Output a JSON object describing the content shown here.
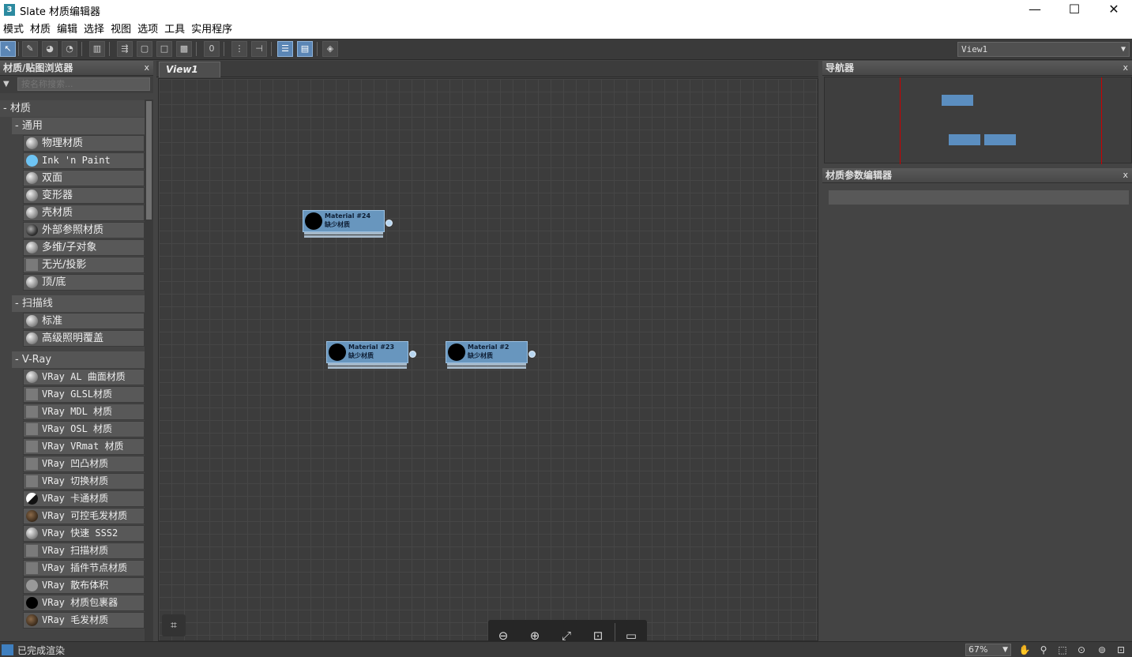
{
  "window": {
    "title": "Slate 材质编辑器",
    "app_icon": "3",
    "minimize": "—",
    "maximize": "☐",
    "close": "✕"
  },
  "menu": [
    "模式",
    "材质",
    "编辑",
    "选择",
    "视图",
    "选项",
    "工具",
    "实用程序"
  ],
  "toolbar": {
    "view_select": "View1"
  },
  "browser": {
    "title": "材质/贴图浏览器",
    "close": "x",
    "search_placeholder": "按名称搜索...",
    "root_label": "- 材质",
    "groups": [
      {
        "label": "- 通用",
        "items": [
          {
            "label": "物理材质",
            "swatch": "sph"
          },
          {
            "label": "Ink 'n Paint",
            "swatch": "blue"
          },
          {
            "label": "双面",
            "swatch": "sph"
          },
          {
            "label": "变形器",
            "swatch": "sph"
          },
          {
            "label": "壳材质",
            "swatch": "sph"
          },
          {
            "label": "外部参照材质",
            "swatch": "dark"
          },
          {
            "label": "多维/子对象",
            "swatch": "sph"
          },
          {
            "label": "无光/投影",
            "swatch": "sq"
          },
          {
            "label": "顶/底",
            "swatch": "sph"
          }
        ]
      },
      {
        "label": "- 扫描线",
        "items": [
          {
            "label": "标准",
            "swatch": "sph"
          },
          {
            "label": "高级照明覆盖",
            "swatch": "sph"
          }
        ]
      },
      {
        "label": "- V-Ray",
        "items": [
          {
            "label": "VRay AL 曲面材质",
            "swatch": "sph"
          },
          {
            "label": "VRay GLSL材质",
            "swatch": "sq"
          },
          {
            "label": "VRay MDL 材质",
            "swatch": "sq"
          },
          {
            "label": "VRay OSL 材质",
            "swatch": "sq"
          },
          {
            "label": "VRay VRmat 材质",
            "swatch": "sq"
          },
          {
            "label": "VRay 凹凸材质",
            "swatch": "sq"
          },
          {
            "label": "VRay 切换材质",
            "swatch": "sq"
          },
          {
            "label": "VRay 卡通材质",
            "swatch": "toon"
          },
          {
            "label": "VRay 可控毛发材质",
            "swatch": "fur"
          },
          {
            "label": "VRay 快速 SSS2",
            "swatch": "sph"
          },
          {
            "label": "VRay 扫描材质",
            "swatch": "sq"
          },
          {
            "label": "VRay 插件节点材质",
            "swatch": "sq"
          },
          {
            "label": "VRay 散布体积",
            "swatch": "gray"
          },
          {
            "label": "VRay 材质包裹器",
            "swatch": "blk"
          },
          {
            "label": "VRay 毛发材质",
            "swatch": "fur"
          }
        ]
      }
    ]
  },
  "view": {
    "tab": "View1",
    "nodes": [
      {
        "name": "Material #24",
        "status": "缺少材质"
      },
      {
        "name": "Material #23",
        "status": "缺少材质"
      },
      {
        "name": "Material #2",
        "status": "缺少材质"
      }
    ]
  },
  "navigator": {
    "title": "导航器",
    "close": "x"
  },
  "param_editor": {
    "title": "材质参数编辑器",
    "close": "x"
  },
  "status": {
    "text": "已完成渲染",
    "zoom": "67%"
  }
}
